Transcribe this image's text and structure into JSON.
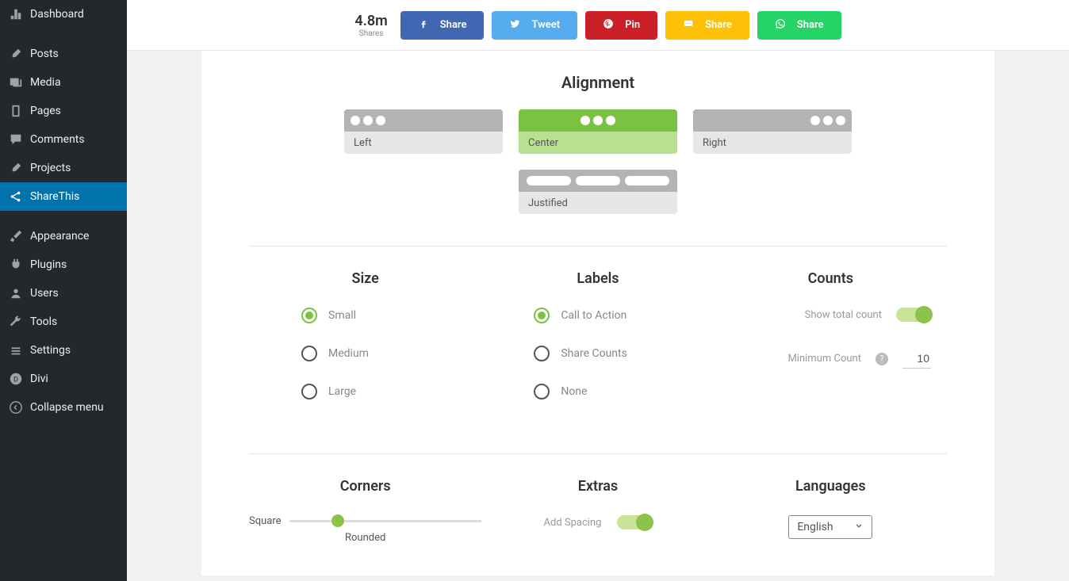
{
  "sidebar": {
    "items": [
      {
        "label": "Dashboard",
        "icon": "dashboard"
      },
      {
        "label": "Posts",
        "icon": "pin"
      },
      {
        "label": "Media",
        "icon": "media"
      },
      {
        "label": "Pages",
        "icon": "page"
      },
      {
        "label": "Comments",
        "icon": "comment"
      },
      {
        "label": "Projects",
        "icon": "pin"
      },
      {
        "label": "ShareThis",
        "icon": "share",
        "active": true
      },
      {
        "label": "Appearance",
        "icon": "brush"
      },
      {
        "label": "Plugins",
        "icon": "plug"
      },
      {
        "label": "Users",
        "icon": "user"
      },
      {
        "label": "Tools",
        "icon": "wrench"
      },
      {
        "label": "Settings",
        "icon": "settings"
      },
      {
        "label": "Divi",
        "icon": "divi"
      },
      {
        "label": "Collapse menu",
        "icon": "collapse"
      }
    ]
  },
  "share_total": {
    "value": "4.8m",
    "label": "Shares"
  },
  "share_buttons": [
    {
      "label": "Share",
      "class": "fb"
    },
    {
      "label": "Tweet",
      "class": "tw"
    },
    {
      "label": "Pin",
      "class": "pn"
    },
    {
      "label": "Share",
      "class": "sms"
    },
    {
      "label": "Share",
      "class": "wa"
    }
  ],
  "alignment": {
    "title": "Alignment",
    "options": [
      {
        "label": "Left",
        "layout": "left"
      },
      {
        "label": "Center",
        "layout": "center",
        "selected": true
      },
      {
        "label": "Right",
        "layout": "right"
      },
      {
        "label": "Justified",
        "layout": "just"
      }
    ]
  },
  "size": {
    "title": "Size",
    "options": [
      "Small",
      "Medium",
      "Large"
    ],
    "selected": "Small"
  },
  "labels": {
    "title": "Labels",
    "options": [
      "Call to Action",
      "Share Counts",
      "None"
    ],
    "selected": "Call to Action"
  },
  "counts": {
    "title": "Counts",
    "show_total": "Show total count",
    "min_label": "Minimum Count",
    "min_value": "10"
  },
  "corners": {
    "title": "Corners",
    "left_label": "Square",
    "right_label": "Rounded"
  },
  "extras": {
    "title": "Extras",
    "spacing": "Add Spacing"
  },
  "languages": {
    "title": "Languages",
    "selected": "English"
  }
}
